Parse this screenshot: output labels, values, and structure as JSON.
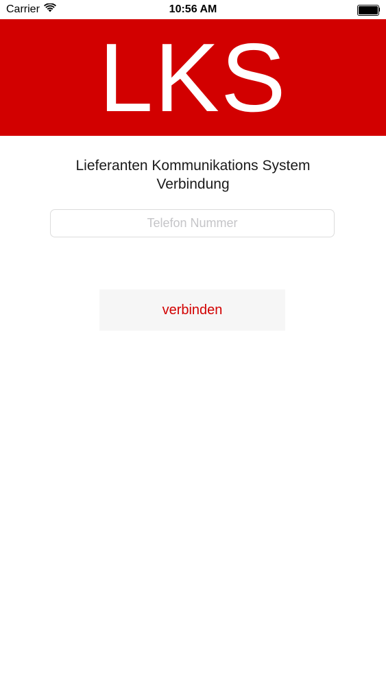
{
  "status_bar": {
    "carrier": "Carrier",
    "time": "10:56 AM",
    "wifi_icon": "wifi-icon",
    "battery_icon": "battery-icon",
    "battery_level": 1.0
  },
  "banner": {
    "logo_text": "LKS",
    "background_color": "#d20000"
  },
  "main": {
    "title_line1": "Lieferanten Kommunikations System",
    "title_line2": "Verbindung",
    "phone_placeholder": "Telefon Nummer",
    "phone_value": "",
    "connect_label": "verbinden",
    "accent_color": "#d20000"
  }
}
